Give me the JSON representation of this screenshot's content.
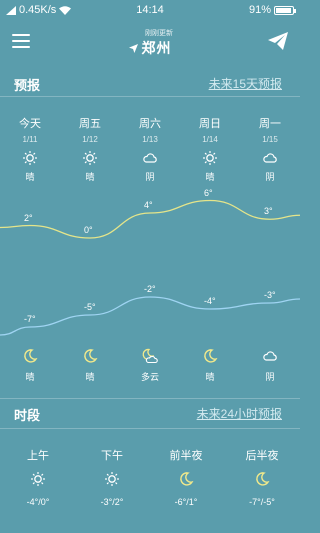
{
  "status_bar": {
    "speed": "0.45K/s",
    "time": "14:14",
    "battery": "91%",
    "battery_level": 0.91
  },
  "header": {
    "update_note": "刚刚更新",
    "city": "郑州"
  },
  "forecast": {
    "title": "预报",
    "more_link": "未来15天预报",
    "days": [
      {
        "name": "今天",
        "date": "1/11",
        "day_icon": "sun-icon",
        "day_cond": "晴",
        "high": "2°",
        "low": "-7°",
        "night_icon": "moon-icon",
        "night_cond": "晴"
      },
      {
        "name": "周五",
        "date": "1/12",
        "day_icon": "sun-icon",
        "day_cond": "晴",
        "high": "0°",
        "low": "-5°",
        "night_icon": "moon-icon",
        "night_cond": "晴"
      },
      {
        "name": "周六",
        "date": "1/13",
        "day_icon": "cloud-icon",
        "day_cond": "阴",
        "high": "4°",
        "low": "-2°",
        "night_icon": "moon-cloud-icon",
        "night_cond": "多云"
      },
      {
        "name": "周日",
        "date": "1/14",
        "day_icon": "sun-icon",
        "day_cond": "晴",
        "high": "6°",
        "low": "-4°",
        "night_icon": "moon-icon",
        "night_cond": "晴"
      },
      {
        "name": "周一",
        "date": "1/15",
        "day_icon": "cloud-icon",
        "day_cond": "阴",
        "high": "3°",
        "low": "-3°",
        "night_icon": "cloud-icon",
        "night_cond": "阴"
      }
    ],
    "chart_data": {
      "type": "line",
      "categories": [
        "今天",
        "周五",
        "周六",
        "周日",
        "周一"
      ],
      "series": [
        {
          "name": "",
          "values": [
            2,
            0,
            4,
            6,
            3
          ],
          "color": "#e5e58a"
        },
        {
          "name": "",
          "values": [
            -7,
            -5,
            -2,
            -4,
            -3
          ],
          "color": "#9fd4f2"
        }
      ]
    }
  },
  "periods": {
    "title": "时段",
    "more_link": "未来24小时预报",
    "items": [
      {
        "name": "上午",
        "icon": "sun-icon",
        "temp": "-4°/0°"
      },
      {
        "name": "下午",
        "icon": "sun-icon",
        "temp": "-3°/2°"
      },
      {
        "name": "前半夜",
        "icon": "moon-icon",
        "temp": "-6°/1°"
      },
      {
        "name": "后半夜",
        "icon": "moon-icon",
        "temp": "-7°/-5°"
      }
    ]
  },
  "colors": {
    "background": "#5a9dac",
    "high_line": "#e5e58a",
    "low_line": "#9fd4f2",
    "night_icon": "#f1e98b"
  }
}
